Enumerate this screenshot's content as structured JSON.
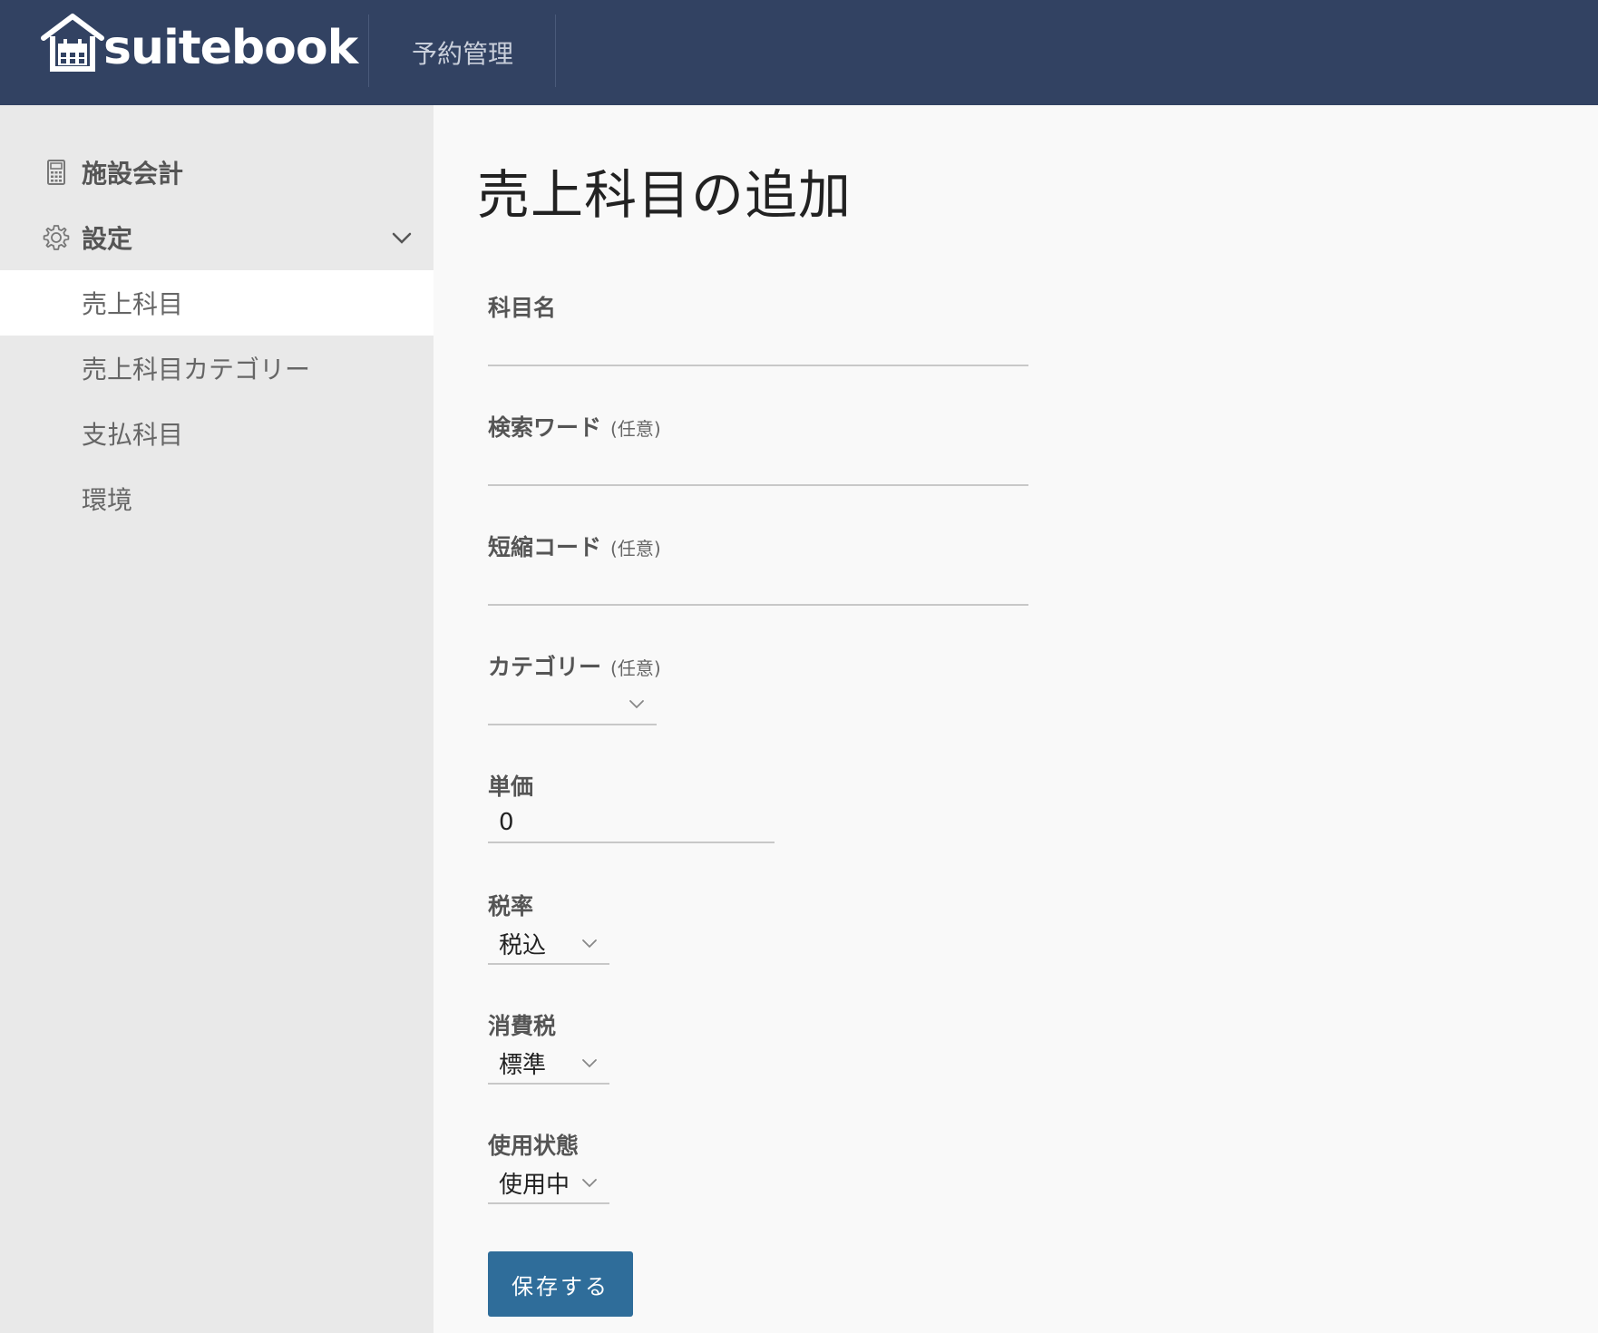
{
  "header": {
    "app_name": "suitebook",
    "nav_link": "予約管理"
  },
  "sidebar": {
    "items": [
      {
        "label": "施設会計",
        "icon": "calculator-icon"
      },
      {
        "label": "設定",
        "icon": "gear-icon",
        "expanded": true
      }
    ],
    "sub_items": [
      {
        "label": "売上科目",
        "active": true
      },
      {
        "label": "売上科目カテゴリー",
        "active": false
      },
      {
        "label": "支払科目",
        "active": false
      },
      {
        "label": "環境",
        "active": false
      }
    ]
  },
  "main": {
    "title": "売上科目の追加",
    "optional_tag": "(任意)",
    "fields": {
      "name": {
        "label": "科目名",
        "value": ""
      },
      "search_word": {
        "label": "検索ワード",
        "value": ""
      },
      "short_code": {
        "label": "短縮コード",
        "value": ""
      },
      "category": {
        "label": "カテゴリー",
        "value": ""
      },
      "unit_price": {
        "label": "単価",
        "value": "0"
      },
      "tax_rate": {
        "label": "税率",
        "value": "税込"
      },
      "consumption_tax": {
        "label": "消費税",
        "value": "標準"
      },
      "status": {
        "label": "使用状態",
        "value": "使用中"
      }
    },
    "save_label": "保存する"
  },
  "colors": {
    "header_bg": "#324262",
    "sidebar_bg": "#e9e9e9",
    "button_bg": "#2f6d9a"
  }
}
